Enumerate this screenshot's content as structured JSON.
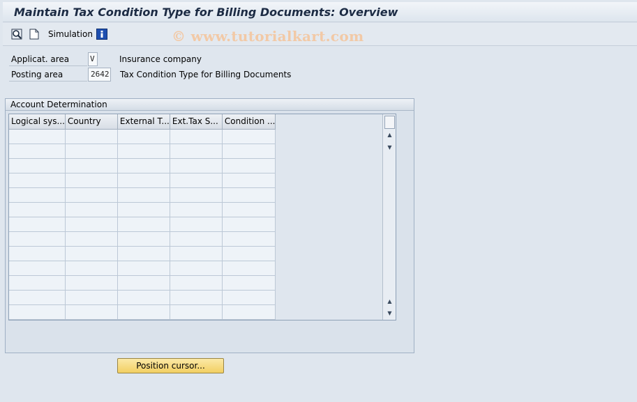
{
  "window": {
    "title": "Maintain Tax Condition Type for Billing Documents: Overview"
  },
  "toolbar": {
    "icons": [
      "find-icon",
      "new-document-icon",
      "info-icon"
    ],
    "simulation_label": "Simulation",
    "watermark": "© www.tutorialkart.com"
  },
  "fields": {
    "applicat_area": {
      "label": "Applicat. area",
      "value": "V",
      "description": "Insurance company"
    },
    "posting_area": {
      "label": "Posting area",
      "value": "2642",
      "description": "Tax Condition Type for Billing Documents"
    }
  },
  "groupbox": {
    "title": "Account Determination",
    "columns": [
      "Logical sys...",
      "Country",
      "External T...",
      "Ext.Tax S...",
      "Condition ..."
    ],
    "row_count": 13
  },
  "buttons": {
    "position_cursor": "Position cursor..."
  },
  "colors": {
    "button_accent": "#f2cf62",
    "title_text": "#1c2b44"
  }
}
